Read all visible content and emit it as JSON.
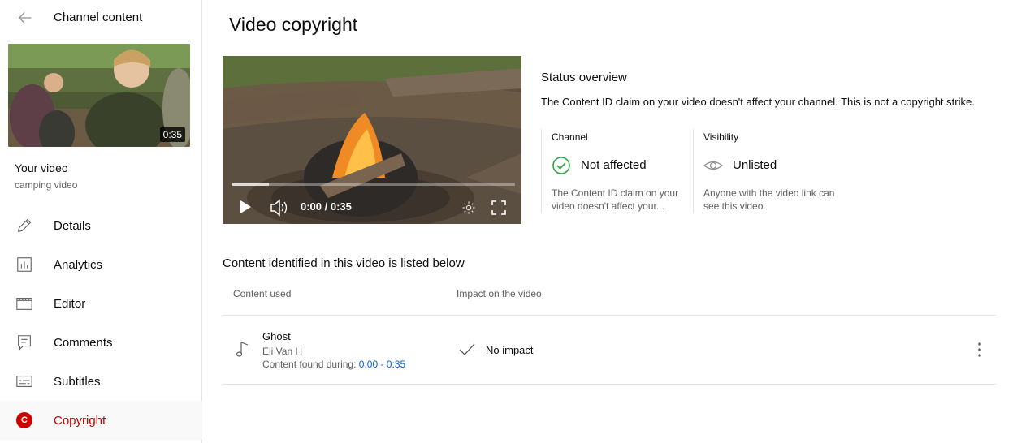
{
  "sidebar": {
    "back_label": "Channel content",
    "thumbnail_duration": "0:35",
    "your_video_label": "Your video",
    "video_title": "camping video",
    "items": [
      {
        "label": "Details",
        "icon": "pencil-icon"
      },
      {
        "label": "Analytics",
        "icon": "analytics-icon"
      },
      {
        "label": "Editor",
        "icon": "editor-icon"
      },
      {
        "label": "Comments",
        "icon": "comments-icon"
      },
      {
        "label": "Subtitles",
        "icon": "subtitles-icon"
      },
      {
        "label": "Copyright",
        "icon": "copyright-badge",
        "badge": "C",
        "active": true
      }
    ]
  },
  "main": {
    "title": "Video copyright",
    "player": {
      "time": "0:00 / 0:35",
      "progress": 0.13
    },
    "status": {
      "title": "Status overview",
      "description": "The Content ID claim on your video doesn't affect your channel. This is not a copyright strike.",
      "channel": {
        "title": "Channel",
        "value": "Not affected",
        "description": "The Content ID claim on your video doesn't affect your..."
      },
      "visibility": {
        "title": "Visibility",
        "value": "Unlisted",
        "description": "Anyone with the video link can see this video."
      }
    },
    "content": {
      "heading": "Content identified in this video is listed below",
      "columns": [
        "Content used",
        "Impact on the video"
      ],
      "rows": [
        {
          "title": "Ghost",
          "artist": "Eli Van H",
          "found_label": "Content found during: ",
          "range": "0:00 - 0:35",
          "impact": "No impact"
        }
      ]
    }
  },
  "colors": {
    "accent_red": "#cc0000",
    "link_blue": "#065fd4",
    "check_green": "#2ba640"
  }
}
